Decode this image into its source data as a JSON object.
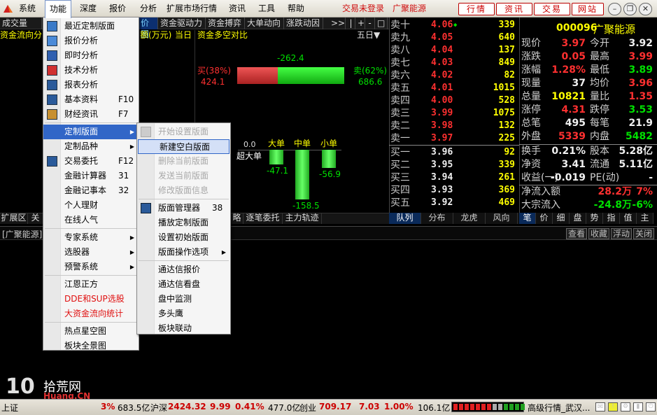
{
  "menubar": {
    "items": [
      "系统",
      "功能",
      "深度",
      "报价",
      "分析",
      "扩展市场行情",
      "资讯",
      "工具",
      "帮助"
    ],
    "status_links": [
      "交易未登录",
      "广聚能源"
    ],
    "nav_buttons": [
      "行情",
      "资讯",
      "交易",
      "网站"
    ]
  },
  "tabrow": {
    "items": [
      "成交量",
      "价图",
      "资金驱动力",
      "资金搏弈",
      "大单动向",
      "涨跌动因"
    ],
    "controls": [
      ">>",
      "|",
      "+",
      "-",
      "□"
    ]
  },
  "left_panel": {
    "header": "资金流向分",
    "subheader": "额(万元)",
    "subheader_day": "当日",
    "title": "资金多空对比",
    "period": "五日▼"
  },
  "capital": {
    "net_value": "-262.4",
    "buy_label": "买(38%)",
    "buy_value": "424.1",
    "sell_label": "卖(62%)",
    "sell_value": "686.6",
    "buy_pct": 38,
    "sell_pct": 62,
    "orders": [
      {
        "label": "超大单",
        "value": "0.0",
        "amount": 0.0
      },
      {
        "label": "大单",
        "value": "-47.1",
        "amount": -47.1
      },
      {
        "label": "中单",
        "value": "-158.5",
        "amount": -158.5
      },
      {
        "label": "小单",
        "value": "-56.9",
        "amount": -56.9
      }
    ]
  },
  "order_book": {
    "sells": [
      {
        "label": "卖十",
        "price": "4.06",
        "vol": "339",
        "mark": "◆"
      },
      {
        "label": "卖九",
        "price": "4.05",
        "vol": "640"
      },
      {
        "label": "卖八",
        "price": "4.04",
        "vol": "137"
      },
      {
        "label": "卖七",
        "price": "4.03",
        "vol": "849"
      },
      {
        "label": "卖六",
        "price": "4.02",
        "vol": "82"
      },
      {
        "label": "卖五",
        "price": "4.01",
        "vol": "1015"
      },
      {
        "label": "卖四",
        "price": "4.00",
        "vol": "528"
      },
      {
        "label": "卖三",
        "price": "3.99",
        "vol": "1075"
      },
      {
        "label": "卖二",
        "price": "3.98",
        "vol": "132"
      },
      {
        "label": "卖一",
        "price": "3.97",
        "vol": "225"
      }
    ],
    "buys": [
      {
        "label": "买一",
        "price": "3.96",
        "vol": "92"
      },
      {
        "label": "买二",
        "price": "3.95",
        "vol": "339"
      },
      {
        "label": "买三",
        "price": "3.94",
        "vol": "261"
      },
      {
        "label": "买四",
        "price": "3.93",
        "vol": "369"
      },
      {
        "label": "买五",
        "price": "3.92",
        "vol": "469"
      }
    ],
    "tabs": [
      "队列",
      "分布",
      "龙虎",
      "风向"
    ]
  },
  "info": {
    "code": "000096",
    "name": "广聚能源",
    "rows": [
      {
        "l1": "现价",
        "v1": "3.97",
        "c1": "red",
        "l2": "今开",
        "v2": "3.92",
        "c2": "white"
      },
      {
        "l1": "涨跌",
        "v1": "0.05",
        "c1": "red",
        "l2": "最高",
        "v2": "3.99",
        "c2": "red"
      },
      {
        "l1": "涨幅",
        "v1": "1.28%",
        "c1": "red",
        "l2": "最低",
        "v2": "3.89",
        "c2": "green"
      },
      {
        "l1": "现量",
        "v1": "37",
        "c1": "white",
        "l2": "均价",
        "v2": "3.96",
        "c2": "red"
      },
      {
        "l1": "总量",
        "v1": "10821",
        "c1": "yellow",
        "l2": "量比",
        "v2": "1.35",
        "c2": "red"
      },
      {
        "l1": "涨停",
        "v1": "4.31",
        "c1": "red",
        "l2": "跌停",
        "v2": "3.53",
        "c2": "green"
      },
      {
        "l1": "总笔",
        "v1": "495",
        "c1": "white",
        "l2": "每笔",
        "v2": "21.9",
        "c2": "white"
      },
      {
        "l1": "外盘",
        "v1": "5339",
        "c1": "red",
        "l2": "内盘",
        "v2": "5482",
        "c2": "green"
      }
    ],
    "rows2": [
      {
        "l1": "换手",
        "v1": "0.21%",
        "c1": "white",
        "l2": "股本",
        "v2": "5.28亿",
        "c2": "white"
      },
      {
        "l1": "净资",
        "v1": "3.41",
        "c1": "white",
        "l2": "流通",
        "v2": "5.11亿",
        "c2": "white"
      },
      {
        "l1": "收益(一)",
        "v1": "-0.019",
        "c1": "white",
        "l2": "PE(动)",
        "v2": "-",
        "c2": "white"
      }
    ],
    "flow": [
      {
        "label": "净流入额",
        "value": "28.2万",
        "pct": "7%",
        "color": "red"
      },
      {
        "label": "大宗流入",
        "value": "-24.8万",
        "pct": "-6%",
        "color": "green"
      }
    ],
    "tabs": [
      "笔",
      "价",
      "细",
      "盘",
      "势",
      "指",
      "值",
      "主"
    ]
  },
  "bottom": {
    "left_tabs": [
      "扩展区",
      "关"
    ],
    "mid_tabs": [
      "略",
      "逐笔委托",
      "主力轨迹"
    ],
    "stock_label": "[广聚能源]",
    "buttons": [
      "查看",
      "收藏",
      "浮动",
      "关闭"
    ]
  },
  "function_menu": {
    "items": [
      {
        "label": "最近定制版面",
        "icon": "recent-layout-icon"
      },
      {
        "label": "报价分析",
        "icon": "quote-analysis-icon"
      },
      {
        "label": "即时分析",
        "icon": "realtime-chart-icon"
      },
      {
        "label": "技术分析",
        "icon": "candlestick-icon"
      },
      {
        "label": "报表分析",
        "icon": "report-icon"
      },
      {
        "label": "基本资料",
        "shortcut": "F10",
        "icon": "f10-icon"
      },
      {
        "label": "财经资讯",
        "shortcut": "F7",
        "icon": "news-icon"
      },
      {
        "label": "定制版面",
        "submenu": true,
        "highlighted": true
      },
      {
        "label": "定制品种",
        "submenu": true
      },
      {
        "label": "交易委托",
        "shortcut": "F12",
        "icon": "f12-icon"
      },
      {
        "label": "金融计算器",
        "shortcut": "31"
      },
      {
        "label": "金融记事本",
        "shortcut": "32"
      },
      {
        "label": "个人理财"
      },
      {
        "label": "在线人气"
      },
      {
        "label": "专家系统",
        "submenu": true
      },
      {
        "label": "选股器",
        "submenu": true
      },
      {
        "label": "预警系统",
        "submenu": true
      },
      {
        "label": "江恩正方"
      },
      {
        "label": "DDE和SUP选股",
        "red": true
      },
      {
        "label": "大资金流向统计",
        "red": true
      },
      {
        "label": "热点星空图"
      },
      {
        "label": "板块全景图"
      }
    ]
  },
  "layout_submenu": {
    "items": [
      {
        "label": "开始设置版面",
        "disabled": true
      },
      {
        "label": "新建空白版面",
        "selected": true
      },
      {
        "label": "删除当前版面",
        "disabled": true
      },
      {
        "label": "发送当前版面",
        "disabled": true
      },
      {
        "label": "修改版面信息",
        "disabled": true
      },
      {
        "label": "版面管理器",
        "shortcut": "38"
      },
      {
        "label": "播放定制版面"
      },
      {
        "label": "设置初始版面"
      },
      {
        "label": "版面操作选项",
        "submenu": true
      },
      {
        "label": "通达信报价"
      },
      {
        "label": "通达信看盘"
      },
      {
        "label": "盘中监测"
      },
      {
        "label": "多头鹰"
      },
      {
        "label": "板块联动"
      }
    ]
  },
  "watermark": {
    "text1": "拾荒网",
    "text2": "Huang.CN",
    "num": "10"
  },
  "statusbar": {
    "idx1_label": "上证",
    "idx1_pct": "3%",
    "idx1_amt": "683.5亿",
    "idx2_label": "沪深",
    "idx2_val": "2424.32",
    "idx2_chg": "9.99",
    "idx2_pct": "0.41%",
    "idx2_amt": "477.0亿",
    "idx3_label": "创业",
    "idx3_val": "709.17",
    "idx3_chg": "7.03",
    "idx3_pct": "1.00%",
    "idx3_amt": "106.1亿",
    "right_text": "高级行情_武汉..."
  },
  "colors": {
    "red": "#ff3030",
    "green": "#00e000",
    "yellow": "#ffff00",
    "highlight": "#3166c7"
  }
}
